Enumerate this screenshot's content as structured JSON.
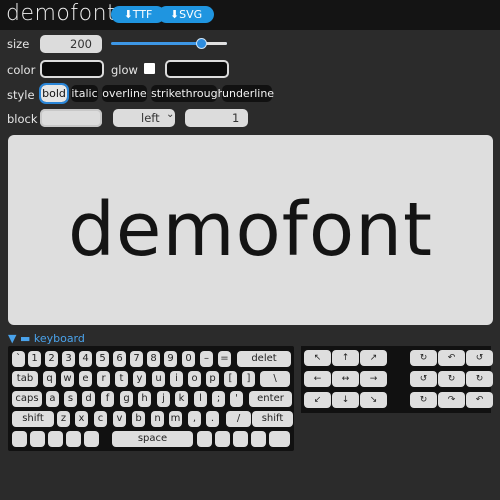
{
  "header": {
    "title": "demofont",
    "ttf_button": "⬇TTF",
    "svg_button": "⬇SVG"
  },
  "controls": {
    "size_label": "size",
    "size_value": "200",
    "size_slider_fraction": 0.78,
    "color_label": "color",
    "glow_label": "glow",
    "style_label": "style",
    "styles": [
      "bold",
      "italic",
      "overline",
      "strikethrough",
      "underline"
    ],
    "active_style": "bold",
    "block_label": "block",
    "align_value": "left",
    "align_chevron": "⌄",
    "block_number": "1"
  },
  "preview": {
    "text": "demofont"
  },
  "keyboard": {
    "toggle_label": "▼ ▬ keyboard",
    "rows": [
      [
        "`",
        "1",
        "2",
        "3",
        "4",
        "5",
        "6",
        "7",
        "8",
        "9",
        "0",
        "–",
        "=",
        "delet"
      ],
      [
        "tab",
        "q",
        "w",
        "e",
        "r",
        "t",
        "y",
        "u",
        "i",
        "o",
        "p",
        "[",
        "]",
        "\\"
      ],
      [
        "caps",
        "a",
        "s",
        "d",
        "f",
        "g",
        "h",
        "j",
        "k",
        "l",
        ";",
        "'",
        "enter"
      ],
      [
        "shift",
        "z",
        "x",
        "c",
        "v",
        "b",
        "n",
        "m",
        ",",
        ".",
        "/",
        "shift"
      ],
      [
        "",
        "",
        "",
        "",
        "",
        "space",
        "",
        "",
        "",
        "",
        ""
      ]
    ],
    "nav_left": [
      [
        "↖",
        "↑",
        "↗"
      ],
      [
        "←",
        "↔",
        "→"
      ],
      [
        "↙",
        "↓",
        "↘"
      ]
    ],
    "nav_right": [
      [
        "↻",
        "↶",
        "↺"
      ],
      [
        "↺",
        "↻",
        "↻"
      ],
      [
        "↻",
        "↷",
        "↶"
      ]
    ]
  }
}
